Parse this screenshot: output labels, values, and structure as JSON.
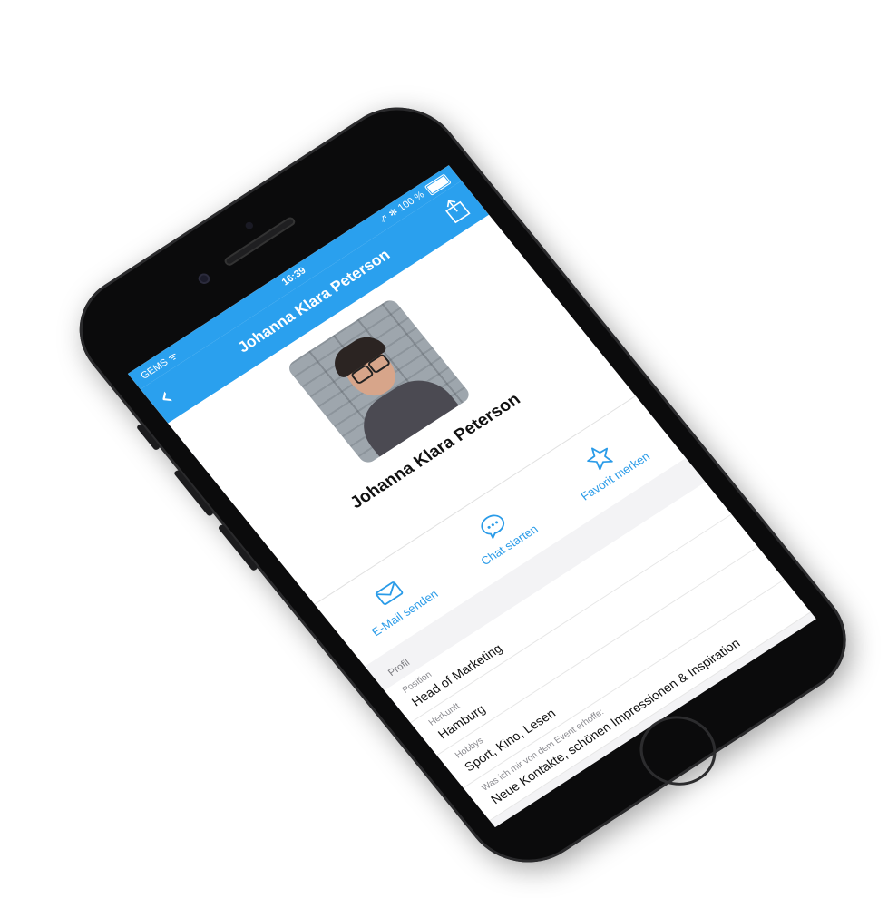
{
  "status_bar": {
    "carrier": "GEMS ᯤ",
    "time": "16:39",
    "battery": "⇗ ✻ 100 %"
  },
  "nav": {
    "back_icon": "chevron-left-icon",
    "back_glyph": "‹",
    "title": "Johanna Klara Peterson",
    "share_icon": "share-icon"
  },
  "profile": {
    "name": "Johanna Klara Peterson"
  },
  "actions": {
    "email": {
      "label": "E-Mail senden",
      "icon": "envelope-icon"
    },
    "chat": {
      "label": "Chat starten",
      "icon": "chat-bubble-icon"
    },
    "favorite": {
      "label": "Favorit merken",
      "icon": "star-icon"
    }
  },
  "section": {
    "title": "Profil",
    "fields": [
      {
        "label": "Position",
        "value": "Head of Marketing"
      },
      {
        "label": "Herkunft",
        "value": "Hamburg"
      },
      {
        "label": "Hobbys",
        "value": "Sport, Kino, Lesen"
      },
      {
        "label": "Was ich mir von dem Event erhoffe:",
        "value": "Neue Kontakte, schönen Impressionen & Inspiration"
      }
    ]
  },
  "colors": {
    "accent": "#2aa0ee",
    "device": "#0b0b0c"
  }
}
